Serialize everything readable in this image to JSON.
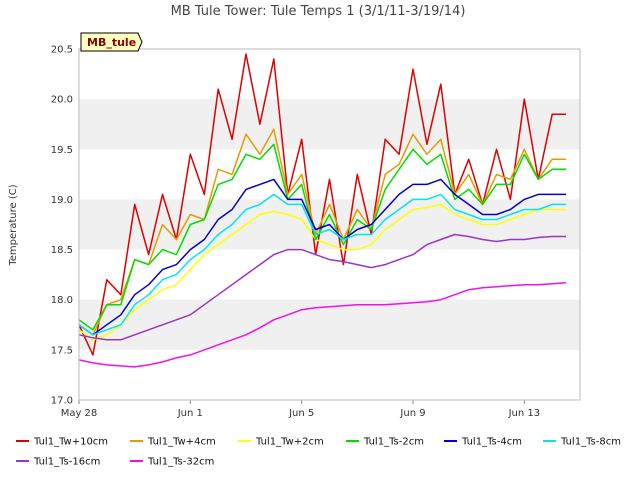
{
  "chart_data": {
    "type": "line",
    "title": "MB Tule Tower: Tule Temps 1 (3/1/11-3/19/14)",
    "ylabel": "Temperature (C)",
    "xlabel": "",
    "badge": "MB_tule",
    "ylim": [
      17.0,
      20.5
    ],
    "yticks": [
      "17.0",
      "17.5",
      "18.0",
      "18.5",
      "19.0",
      "19.5",
      "20.0",
      "20.5"
    ],
    "xlim": [
      0,
      18
    ],
    "xticks": [
      {
        "label": "May 28",
        "day": 0
      },
      {
        "label": "Jun 1",
        "day": 4
      },
      {
        "label": "Jun 5",
        "day": 8
      },
      {
        "label": "Jun 9",
        "day": 12
      },
      {
        "label": "Jun 13",
        "day": 16
      }
    ],
    "grid_bands": true,
    "legend_position": "bottom",
    "x": [
      0.0,
      0.5,
      1.0,
      1.5,
      2.0,
      2.5,
      3.0,
      3.5,
      4.0,
      4.5,
      5.0,
      5.5,
      6.0,
      6.5,
      7.0,
      7.5,
      8.0,
      8.5,
      9.0,
      9.5,
      10.0,
      10.5,
      11.0,
      11.5,
      12.0,
      12.5,
      13.0,
      13.5,
      14.0,
      14.5,
      15.0,
      15.5,
      16.0,
      16.5,
      17.0,
      17.5
    ],
    "series": [
      {
        "name": "Tul1_Tw+10cm",
        "color": "#e00000",
        "values": [
          17.75,
          17.45,
          18.2,
          18.05,
          18.95,
          18.45,
          19.05,
          18.6,
          19.45,
          19.05,
          20.1,
          19.6,
          20.45,
          19.75,
          20.4,
          19.05,
          19.6,
          18.45,
          19.2,
          18.35,
          19.25,
          18.65,
          19.6,
          19.45,
          20.3,
          19.55,
          20.15,
          19.05,
          19.4,
          18.95,
          19.5,
          19.0,
          20.0,
          19.2,
          19.85,
          19.85
        ]
      },
      {
        "name": "Tul1_Tw+4cm",
        "color": "#e89a00",
        "values": [
          17.75,
          17.65,
          17.95,
          18.0,
          18.4,
          18.35,
          18.75,
          18.6,
          18.85,
          18.8,
          19.3,
          19.25,
          19.65,
          19.45,
          19.7,
          19.05,
          19.25,
          18.65,
          18.95,
          18.6,
          18.9,
          18.7,
          19.25,
          19.35,
          19.65,
          19.45,
          19.6,
          19.05,
          19.25,
          18.95,
          19.25,
          19.2,
          19.5,
          19.2,
          19.4,
          19.4
        ]
      },
      {
        "name": "Tul1_Tw+2cm",
        "color": "#ffff00",
        "values": [
          17.7,
          17.6,
          17.65,
          17.75,
          17.9,
          18.0,
          18.1,
          18.15,
          18.3,
          18.45,
          18.55,
          18.65,
          18.75,
          18.85,
          18.88,
          18.85,
          18.8,
          18.6,
          18.55,
          18.5,
          18.5,
          18.55,
          18.7,
          18.8,
          18.9,
          18.92,
          18.95,
          18.85,
          18.8,
          18.75,
          18.75,
          18.8,
          18.85,
          18.9,
          18.9,
          18.9
        ]
      },
      {
        "name": "Tul1_Ts-2cm",
        "color": "#00dd00",
        "values": [
          17.8,
          17.7,
          17.95,
          17.95,
          18.4,
          18.35,
          18.5,
          18.45,
          18.75,
          18.8,
          19.15,
          19.2,
          19.45,
          19.4,
          19.55,
          19.0,
          19.15,
          18.6,
          18.85,
          18.55,
          18.8,
          18.7,
          19.1,
          19.3,
          19.5,
          19.35,
          19.45,
          19.0,
          19.1,
          18.95,
          19.15,
          19.15,
          19.45,
          19.2,
          19.3,
          19.3
        ]
      },
      {
        "name": "Tul1_Ts-4cm",
        "color": "#0000cc",
        "values": [
          17.75,
          17.65,
          17.75,
          17.85,
          18.05,
          18.15,
          18.3,
          18.35,
          18.5,
          18.6,
          18.8,
          18.9,
          19.1,
          19.15,
          19.2,
          19.0,
          19.0,
          18.7,
          18.75,
          18.6,
          18.7,
          18.75,
          18.9,
          19.05,
          19.15,
          19.15,
          19.2,
          19.05,
          18.95,
          18.85,
          18.85,
          18.9,
          19.0,
          19.05,
          19.05,
          19.05
        ]
      },
      {
        "name": "Tul1_Ts-8cm",
        "color": "#00e5ee",
        "values": [
          17.75,
          17.65,
          17.7,
          17.75,
          17.95,
          18.05,
          18.2,
          18.25,
          18.4,
          18.5,
          18.65,
          18.75,
          18.9,
          18.95,
          19.05,
          18.95,
          18.95,
          18.65,
          18.7,
          18.6,
          18.65,
          18.65,
          18.8,
          18.9,
          19.0,
          19.0,
          19.05,
          18.9,
          18.85,
          18.8,
          18.8,
          18.85,
          18.9,
          18.9,
          18.95,
          18.95
        ]
      },
      {
        "name": "Tul1_Ts-16cm",
        "color": "#9933cc",
        "values": [
          17.65,
          17.62,
          17.6,
          17.6,
          17.65,
          17.7,
          17.75,
          17.8,
          17.85,
          17.95,
          18.05,
          18.15,
          18.25,
          18.35,
          18.45,
          18.5,
          18.5,
          18.45,
          18.4,
          18.38,
          18.35,
          18.32,
          18.35,
          18.4,
          18.45,
          18.55,
          18.6,
          18.65,
          18.63,
          18.6,
          18.58,
          18.6,
          18.6,
          18.62,
          18.63,
          18.63
        ]
      },
      {
        "name": "Tul1_Ts-32cm",
        "color": "#ee11ee",
        "values": [
          17.4,
          17.37,
          17.35,
          17.34,
          17.33,
          17.35,
          17.38,
          17.42,
          17.45,
          17.5,
          17.55,
          17.6,
          17.65,
          17.72,
          17.8,
          17.85,
          17.9,
          17.92,
          17.93,
          17.94,
          17.95,
          17.95,
          17.95,
          17.96,
          17.97,
          17.98,
          18.0,
          18.05,
          18.1,
          18.12,
          18.13,
          18.14,
          18.15,
          18.15,
          18.16,
          18.17
        ]
      }
    ]
  }
}
